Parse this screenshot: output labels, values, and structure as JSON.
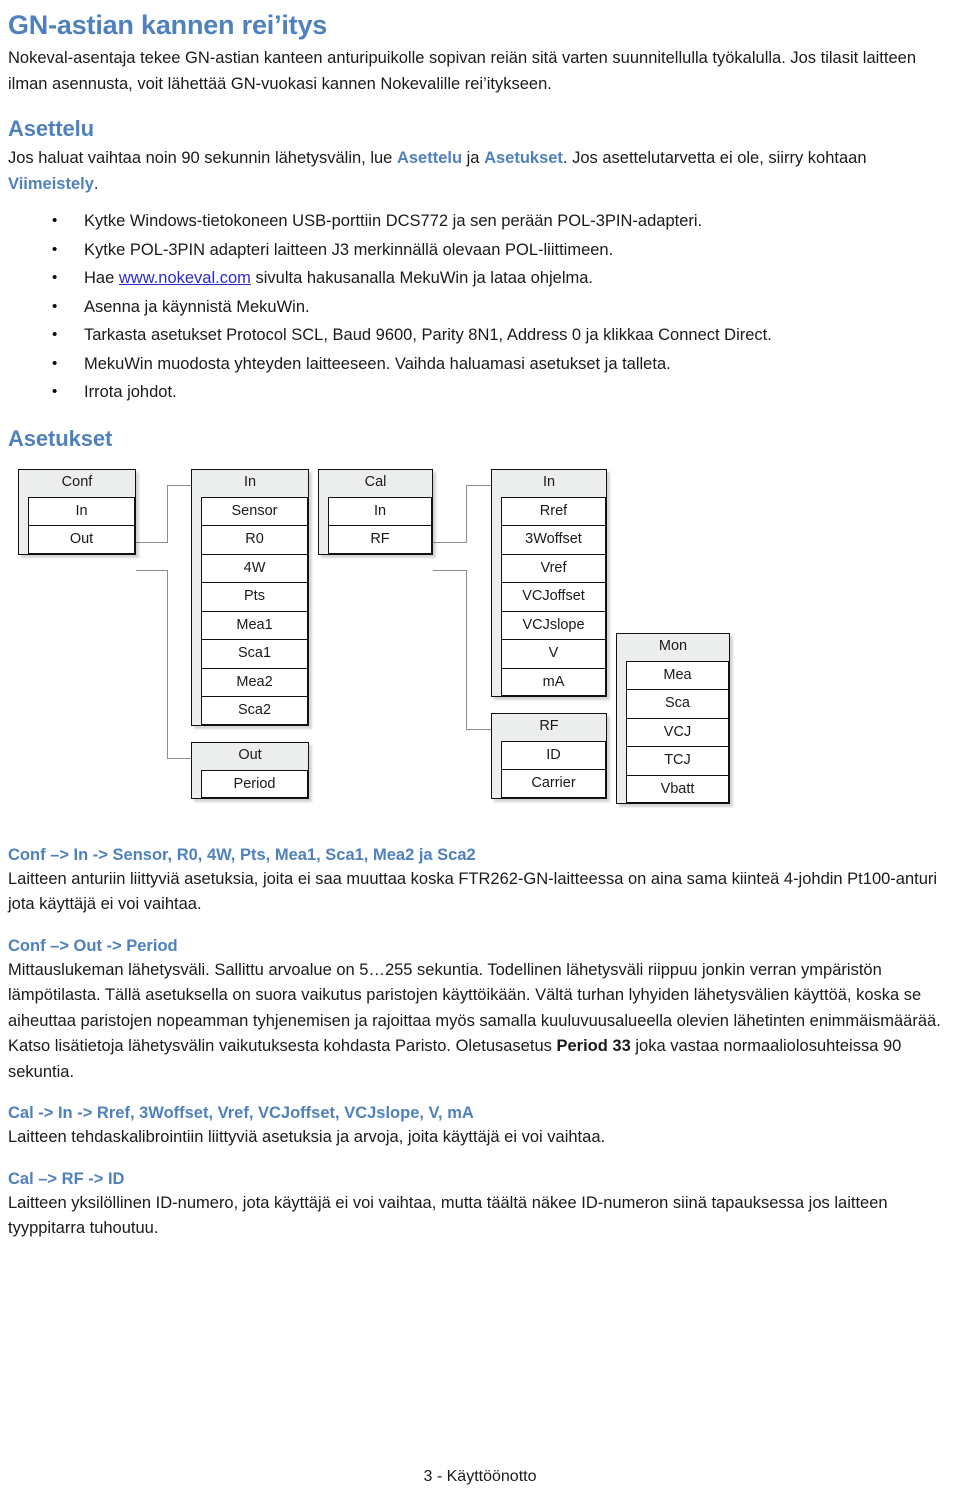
{
  "title": "GN-astian kannen rei’itys",
  "intro": "Nokeval-asentaja tekee GN-astian kanteen anturipuikolle sopivan reiän sitä varten suunnitellulla työkalulla. Jos tilasit laitteen ilman asennusta, voit lähettää GN-vuokasi kannen Nokevalille rei’itykseen.",
  "asettelu": {
    "heading": "Asettelu",
    "line_a": "Jos haluat vaihtaa noin 90 sekunnin lähetysvälin, lue ",
    "link_asettelu": "Asettelu",
    "line_b": " ja ",
    "link_asetukset": "Asetukset",
    "line_c": ". Jos asettelutarvetta ei ole, siirry kohtaan ",
    "link_viimeistely": "Viimeistely",
    "line_d": "."
  },
  "steps": [
    "Kytke Windows-tietokoneen USB-porttiin DCS772 ja sen perään POL-3PIN-adapteri.",
    "Kytke POL-3PIN adapteri laitteen J3 merkinnällä olevaan POL-liittimeen.",
    "Asenna ja käynnistä MekuWin.",
    "Tarkasta asetukset Protocol SCL, Baud 9600, Parity 8N1, Address 0 ja klikkaa Connect Direct.",
    "MekuWin muodosta yhteyden laitteeseen. Vaihda haluamasi asetukset ja talleta.",
    "Irrota johdot."
  ],
  "step_link": {
    "prefix": "Hae ",
    "url_text": "www.nokeval.com",
    "suffix": " sivulta hakusanalla MekuWin ja lataa ohjelma."
  },
  "asetukset": {
    "heading": "Asetukset"
  },
  "diagram": {
    "boxes": [
      {
        "name": "conf",
        "header": "Conf",
        "rows": [
          "In",
          "Out"
        ]
      },
      {
        "name": "conf-in",
        "header": "In",
        "rows": [
          "Sensor",
          "R0",
          "4W",
          "Pts",
          "Mea1",
          "Sca1",
          "Mea2",
          "Sca2"
        ]
      },
      {
        "name": "conf-out",
        "header": "Out",
        "rows": [
          "Period"
        ]
      },
      {
        "name": "cal",
        "header": "Cal",
        "rows": [
          "In",
          "RF"
        ]
      },
      {
        "name": "cal-in",
        "header": "In",
        "rows": [
          "Rref",
          "3Woffset",
          "Vref",
          "VCJoffset",
          "VCJslope",
          "V",
          "mA"
        ]
      },
      {
        "name": "cal-rf",
        "header": "RF",
        "rows": [
          "ID",
          "Carrier"
        ]
      },
      {
        "name": "mon",
        "header": "Mon",
        "rows": [
          "Mea",
          "Sca",
          "VCJ",
          "TCJ",
          "Vbatt"
        ]
      }
    ]
  },
  "sections": [
    {
      "heading": "Conf –> In -> Sensor, R0, 4W, Pts, Mea1, Sca1, Mea2 ja Sca2",
      "body": "Laitteen anturiin liittyviä asetuksia, joita ei saa muuttaa koska FTR262-GN-laitteessa on aina sama kiinteä 4-johdin Pt100-anturi jota käyttäjä ei voi vaihtaa."
    },
    {
      "heading": "Conf –> Out -> Period",
      "body_pre": "Mittauslukeman lähetysväli. Sallittu arvoalue on 5…255 sekuntia. Todellinen lähetysväli riippuu jonkin verran ympäristön lämpötilasta. Tällä asetuksella on suora vaikutus paristojen käyttöikään. Vältä turhan lyhyiden lähetysvälien käyttöä, koska se aiheuttaa paristojen nopeamman tyhjenemisen ja rajoittaa myös samalla kuuluvuusalueella olevien lähetinten enimmäismäärää. Katso lisätietoja lähetysvälin vaikutuksesta kohdasta Paristo. Oletusasetus ",
      "body_bold": "Period 33",
      "body_post": " joka vastaa normaaliolosuhteissa 90 sekuntia."
    },
    {
      "heading": "Cal -> In -> Rref, 3Woffset, Vref, VCJoffset, VCJslope, V, mA",
      "body": "Laitteen tehdaskalibrointiin liittyviä asetuksia ja arvoja, joita käyttäjä ei voi vaihtaa."
    },
    {
      "heading": "Cal –> RF -> ID",
      "body": "Laitteen yksilöllinen ID-numero, jota käyttäjä ei voi vaihtaa, mutta täältä näkee ID-numeron siinä tapauksessa jos laitteen tyyppitarra tuhoutuu."
    }
  ],
  "footer": "3 - Käyttöönotto",
  "colors": {
    "heading_blue": "#4f81bd",
    "link_blue": "#2a2ad0",
    "box_header_gray": "#eceded",
    "connector_gray": "#8d8d8d"
  }
}
